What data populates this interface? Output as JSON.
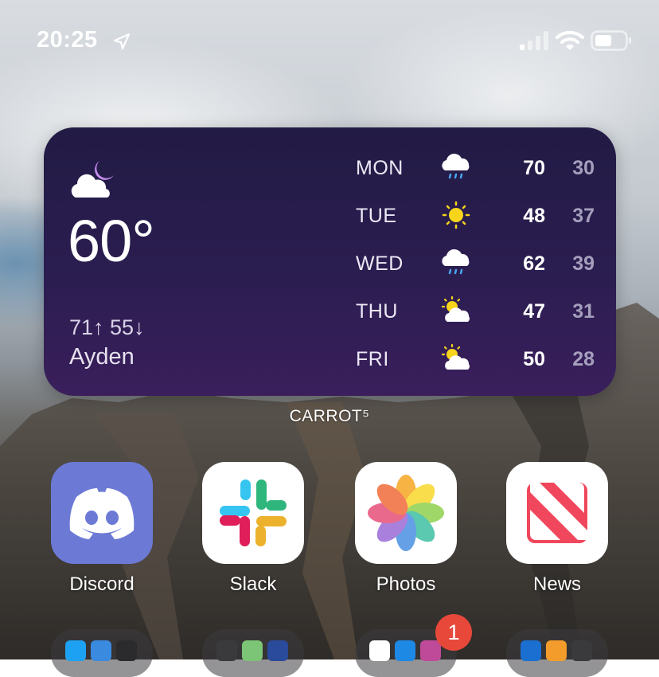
{
  "status_bar": {
    "time": "20:25",
    "location_icon": "location-arrow-icon",
    "signal_icon": "cellular-signal-icon",
    "wifi_icon": "wifi-icon",
    "battery_icon": "battery-icon"
  },
  "weather_widget": {
    "current_icon": "cloud-moon-icon",
    "temperature": "60°",
    "high_low": "71↑ 55↓",
    "location": "Ayden",
    "forecast": [
      {
        "day": "MON",
        "icon": "cloud-rain-icon",
        "high": "70",
        "low": "30"
      },
      {
        "day": "TUE",
        "icon": "sun-icon",
        "high": "48",
        "low": "37"
      },
      {
        "day": "WED",
        "icon": "cloud-rain-icon",
        "high": "62",
        "low": "39"
      },
      {
        "day": "THU",
        "icon": "partly-cloudy-icon",
        "high": "47",
        "low": "31"
      },
      {
        "day": "FRI",
        "icon": "partly-cloudy-icon",
        "high": "50",
        "low": "28"
      }
    ],
    "label": "CARROT⁵"
  },
  "apps": [
    {
      "name": "Discord",
      "icon": "discord-icon",
      "color": "#6c7ad6"
    },
    {
      "name": "Slack",
      "icon": "slack-icon",
      "color": "#ffffff"
    },
    {
      "name": "Photos",
      "icon": "photos-icon",
      "color": "#ffffff"
    },
    {
      "name": "News",
      "icon": "news-icon",
      "color": "#ffffff"
    }
  ],
  "folders": {
    "badge_count": "1"
  },
  "colors": {
    "widget_top": "#221b45",
    "widget_bottom": "#3a1f5c",
    "badge": "#e8483a"
  }
}
